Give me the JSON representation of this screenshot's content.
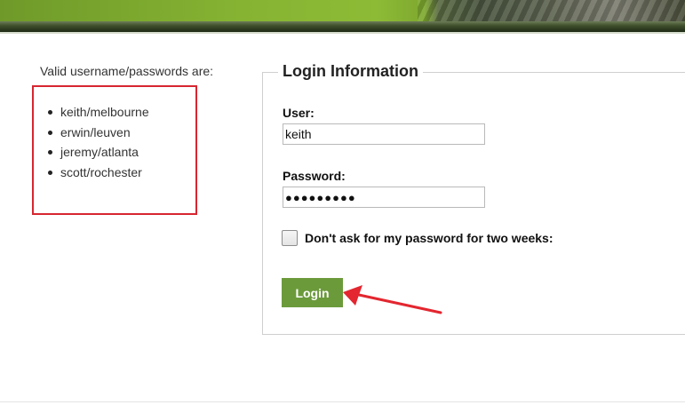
{
  "info": {
    "title": "Valid username/passwords are:",
    "credentials": [
      "keith/melbourne",
      "erwin/leuven",
      "jeremy/atlanta",
      "scott/rochester"
    ]
  },
  "login": {
    "legend": "Login Information",
    "user_label": "User:",
    "user_value": "keith",
    "password_label": "Password:",
    "password_masked": "●●●●●●●●●",
    "remember_label": "Don't ask for my password for two weeks:",
    "remember_checked": false,
    "submit_label": "Login"
  },
  "colors": {
    "accent_green": "#6b9a3b",
    "highlight_red": "#d72630"
  }
}
